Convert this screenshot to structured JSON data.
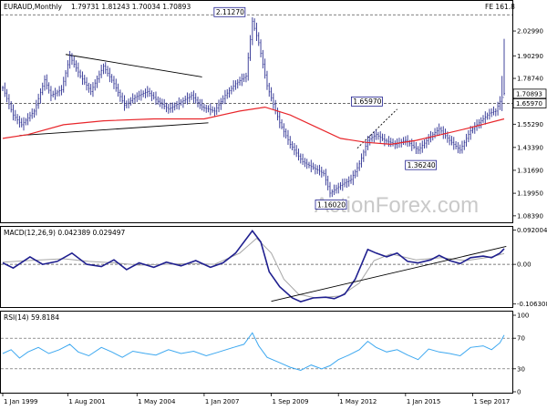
{
  "colors": {
    "price_bar": "#2e3192",
    "ma": "#e8262b",
    "macd": "#1f1f8f",
    "macd_signal": "#a6a6a6",
    "rsi": "#3da8f0",
    "callout_fill": "#ffffff",
    "callout_stroke": "#1f1f8f",
    "trendline": "#000000",
    "grid_dash": "#555555"
  },
  "chart_data": [
    {
      "type": "candlestick",
      "title": "EURAUD,Monthly",
      "ohlc_readout": "1.79731 1.81243 1.70034 1.70893",
      "corner_label": "FE 161.8",
      "watermark": "ActionForex.com",
      "y_ticks": [
        "2.02990",
        "1.90290",
        "1.78740",
        "1.66290",
        "1.55290",
        "1.43390",
        "1.31690",
        "1.19950",
        "1.08390"
      ],
      "y_range": [
        1.06,
        2.17
      ],
      "x_ticks": [
        "1 Jan 1999",
        "1 Aug 2001",
        "1 May 2004",
        "1 Jan 2007",
        "1 Sep 2009",
        "1 May 2012",
        "1 Jan 2015",
        "1 Sep 2017"
      ],
      "x_range": [
        "1999-01",
        "2018-12"
      ],
      "annotations": [
        {
          "label": "2.11270",
          "date": "2008-12",
          "value": 2.1127
        },
        {
          "label": "1.65970",
          "date": "2013-07",
          "value": 1.6597
        },
        {
          "label": "1.36240",
          "date": "2015-07",
          "value": 1.3624
        },
        {
          "label": "1.16020",
          "date": "2012-01",
          "value": 1.1602
        }
      ],
      "price_tags": [
        {
          "label": "1.70893",
          "value": 1.70893
        },
        {
          "label": "1.65970",
          "value": 1.6597
        }
      ],
      "horizontal_levels": [
        {
          "value": 2.1127,
          "style": "dashed"
        },
        {
          "value": 1.6597,
          "style": "dashed"
        }
      ],
      "trendlines": [
        {
          "from": [
            "2001-07",
            1.91
          ],
          "to": [
            "2006-12",
            1.795
          ]
        },
        {
          "from": [
            "1999-09",
            1.495
          ],
          "to": [
            "2007-03",
            1.56
          ]
        },
        {
          "from": [
            "2013-02",
            1.43
          ],
          "to": [
            "2014-09",
            1.63
          ],
          "style": "dotted"
        }
      ],
      "price_path": [
        [
          "1999-01",
          1.74
        ],
        [
          "1999-06",
          1.6
        ],
        [
          "1999-10",
          1.55
        ],
        [
          "2000-04",
          1.62
        ],
        [
          "2000-09",
          1.78
        ],
        [
          "2000-12",
          1.7
        ],
        [
          "2001-05",
          1.73
        ],
        [
          "2001-09",
          1.9
        ],
        [
          "2002-02",
          1.8
        ],
        [
          "2002-07",
          1.72
        ],
        [
          "2003-01",
          1.85
        ],
        [
          "2003-06",
          1.76
        ],
        [
          "2003-11",
          1.65
        ],
        [
          "2004-04",
          1.69
        ],
        [
          "2004-10",
          1.72
        ],
        [
          "2005-03",
          1.67
        ],
        [
          "2005-08",
          1.63
        ],
        [
          "2006-01",
          1.66
        ],
        [
          "2006-07",
          1.7
        ],
        [
          "2006-12",
          1.64
        ],
        [
          "2007-06",
          1.62
        ],
        [
          "2007-11",
          1.7
        ],
        [
          "2008-04",
          1.76
        ],
        [
          "2008-09",
          1.8
        ],
        [
          "2008-12",
          2.08
        ],
        [
          "2009-03",
          1.97
        ],
        [
          "2009-07",
          1.75
        ],
        [
          "2010-01",
          1.56
        ],
        [
          "2010-06",
          1.45
        ],
        [
          "2010-12",
          1.36
        ],
        [
          "2011-05",
          1.33
        ],
        [
          "2011-10",
          1.3
        ],
        [
          "2012-01",
          1.2
        ],
        [
          "2012-06",
          1.24
        ],
        [
          "2012-11",
          1.27
        ],
        [
          "2013-03",
          1.35
        ],
        [
          "2013-07",
          1.47
        ],
        [
          "2013-11",
          1.5
        ],
        [
          "2014-03",
          1.47
        ],
        [
          "2014-08",
          1.45
        ],
        [
          "2015-01",
          1.47
        ],
        [
          "2015-07",
          1.42
        ],
        [
          "2015-12",
          1.48
        ],
        [
          "2016-05",
          1.53
        ],
        [
          "2016-10",
          1.47
        ],
        [
          "2017-03",
          1.42
        ],
        [
          "2017-08",
          1.52
        ],
        [
          "2018-01",
          1.57
        ],
        [
          "2018-05",
          1.61
        ],
        [
          "2018-08",
          1.62
        ],
        [
          "2018-10",
          1.67
        ],
        [
          "2018-12",
          1.71
        ]
      ],
      "ma_path": [
        [
          "1999-01",
          1.48
        ],
        [
          "2000-01",
          1.5
        ],
        [
          "2001-06",
          1.55
        ],
        [
          "2003-01",
          1.57
        ],
        [
          "2005-01",
          1.58
        ],
        [
          "2007-01",
          1.58
        ],
        [
          "2008-06",
          1.62
        ],
        [
          "2009-06",
          1.64
        ],
        [
          "2010-06",
          1.6
        ],
        [
          "2011-06",
          1.54
        ],
        [
          "2012-06",
          1.48
        ],
        [
          "2013-06",
          1.46
        ],
        [
          "2014-06",
          1.45
        ],
        [
          "2015-06",
          1.47
        ],
        [
          "2016-06",
          1.5
        ],
        [
          "2017-06",
          1.53
        ],
        [
          "2018-12",
          1.58
        ]
      ]
    },
    {
      "type": "line",
      "title": "MACD(12,26,9) 0.042389 0.029497",
      "y_ticks": [
        "0.092004",
        "0.00",
        "-0.106308"
      ],
      "y_range": [
        -0.112,
        0.098
      ],
      "trendline": {
        "from": [
          "2009-09",
          -0.099
        ],
        "to": [
          "2019-01",
          0.048
        ]
      },
      "series": [
        {
          "key": "macd",
          "values": [
            [
              "1999-01",
              0.004
            ],
            [
              "1999-06",
              -0.01
            ],
            [
              "2000-02",
              0.02
            ],
            [
              "2000-08",
              0.0
            ],
            [
              "2001-03",
              0.008
            ],
            [
              "2001-10",
              0.03
            ],
            [
              "2002-05",
              0.0
            ],
            [
              "2002-12",
              -0.006
            ],
            [
              "2003-06",
              0.012
            ],
            [
              "2003-12",
              -0.014
            ],
            [
              "2004-06",
              0.004
            ],
            [
              "2005-01",
              -0.008
            ],
            [
              "2005-07",
              0.006
            ],
            [
              "2006-02",
              -0.004
            ],
            [
              "2006-09",
              0.01
            ],
            [
              "2007-04",
              -0.008
            ],
            [
              "2007-10",
              0.004
            ],
            [
              "2008-04",
              0.03
            ],
            [
              "2008-12",
              0.09
            ],
            [
              "2009-04",
              0.06
            ],
            [
              "2009-08",
              -0.02
            ],
            [
              "2010-01",
              -0.06
            ],
            [
              "2010-07",
              -0.09
            ],
            [
              "2010-11",
              -0.1
            ],
            [
              "2011-05",
              -0.09
            ],
            [
              "2011-11",
              -0.088
            ],
            [
              "2012-03",
              -0.092
            ],
            [
              "2012-08",
              -0.08
            ],
            [
              "2013-01",
              -0.04
            ],
            [
              "2013-07",
              0.04
            ],
            [
              "2013-11",
              0.03
            ],
            [
              "2014-04",
              0.02
            ],
            [
              "2014-09",
              0.03
            ],
            [
              "2015-02",
              0.008
            ],
            [
              "2015-07",
              0.004
            ],
            [
              "2016-01",
              0.012
            ],
            [
              "2016-05",
              0.024
            ],
            [
              "2016-10",
              0.01
            ],
            [
              "2017-03",
              0.002
            ],
            [
              "2017-08",
              0.018
            ],
            [
              "2018-02",
              0.022
            ],
            [
              "2018-06",
              0.018
            ],
            [
              "2018-10",
              0.03
            ],
            [
              "2018-12",
              0.042
            ]
          ]
        },
        {
          "key": "signal",
          "values": [
            [
              "1999-01",
              0.006
            ],
            [
              "2000-01",
              0.01
            ],
            [
              "2001-06",
              0.015
            ],
            [
              "2002-06",
              0.008
            ],
            [
              "2003-06",
              0.004
            ],
            [
              "2004-06",
              -0.002
            ],
            [
              "2005-06",
              0.0
            ],
            [
              "2006-06",
              0.002
            ],
            [
              "2007-06",
              0.0
            ],
            [
              "2008-06",
              0.03
            ],
            [
              "2009-02",
              0.07
            ],
            [
              "2009-09",
              0.03
            ],
            [
              "2010-03",
              -0.04
            ],
            [
              "2010-10",
              -0.08
            ],
            [
              "2011-06",
              -0.09
            ],
            [
              "2012-06",
              -0.085
            ],
            [
              "2013-03",
              -0.05
            ],
            [
              "2013-10",
              0.01
            ],
            [
              "2014-06",
              0.028
            ],
            [
              "2015-06",
              0.012
            ],
            [
              "2016-06",
              0.018
            ],
            [
              "2017-06",
              0.01
            ],
            [
              "2018-06",
              0.02
            ],
            [
              "2018-12",
              0.029
            ]
          ]
        }
      ]
    },
    {
      "type": "line",
      "title": "RSI(14) 59.8184",
      "y_ticks": [
        "100",
        "70",
        "30",
        "0"
      ],
      "y_range": [
        0,
        100
      ],
      "levels": [
        70,
        30
      ],
      "series": [
        {
          "key": "rsi",
          "values": [
            [
              "1999-01",
              50
            ],
            [
              "1999-05",
              55
            ],
            [
              "1999-09",
              44
            ],
            [
              "2000-01",
              52
            ],
            [
              "2000-06",
              58
            ],
            [
              "2000-11",
              50
            ],
            [
              "2001-04",
              55
            ],
            [
              "2001-09",
              62
            ],
            [
              "2002-01",
              52
            ],
            [
              "2002-06",
              47
            ],
            [
              "2002-12",
              58
            ],
            [
              "2003-05",
              52
            ],
            [
              "2003-10",
              45
            ],
            [
              "2004-03",
              53
            ],
            [
              "2004-09",
              50
            ],
            [
              "2005-02",
              48
            ],
            [
              "2005-08",
              55
            ],
            [
              "2006-02",
              50
            ],
            [
              "2006-08",
              53
            ],
            [
              "2007-02",
              47
            ],
            [
              "2007-08",
              52
            ],
            [
              "2008-03",
              58
            ],
            [
              "2008-08",
              62
            ],
            [
              "2008-12",
              77
            ],
            [
              "2009-03",
              60
            ],
            [
              "2009-07",
              45
            ],
            [
              "2010-01",
              38
            ],
            [
              "2010-06",
              32
            ],
            [
              "2010-11",
              28
            ],
            [
              "2011-04",
              35
            ],
            [
              "2011-09",
              30
            ],
            [
              "2012-01",
              34
            ],
            [
              "2012-05",
              42
            ],
            [
              "2012-10",
              48
            ],
            [
              "2013-03",
              55
            ],
            [
              "2013-07",
              66
            ],
            [
              "2013-11",
              58
            ],
            [
              "2014-04",
              52
            ],
            [
              "2014-09",
              55
            ],
            [
              "2015-02",
              48
            ],
            [
              "2015-07",
              42
            ],
            [
              "2015-12",
              56
            ],
            [
              "2016-05",
              52
            ],
            [
              "2016-10",
              50
            ],
            [
              "2017-03",
              47
            ],
            [
              "2017-08",
              58
            ],
            [
              "2018-02",
              60
            ],
            [
              "2018-06",
              55
            ],
            [
              "2018-10",
              64
            ],
            [
              "2018-12",
              74
            ]
          ]
        }
      ]
    }
  ]
}
